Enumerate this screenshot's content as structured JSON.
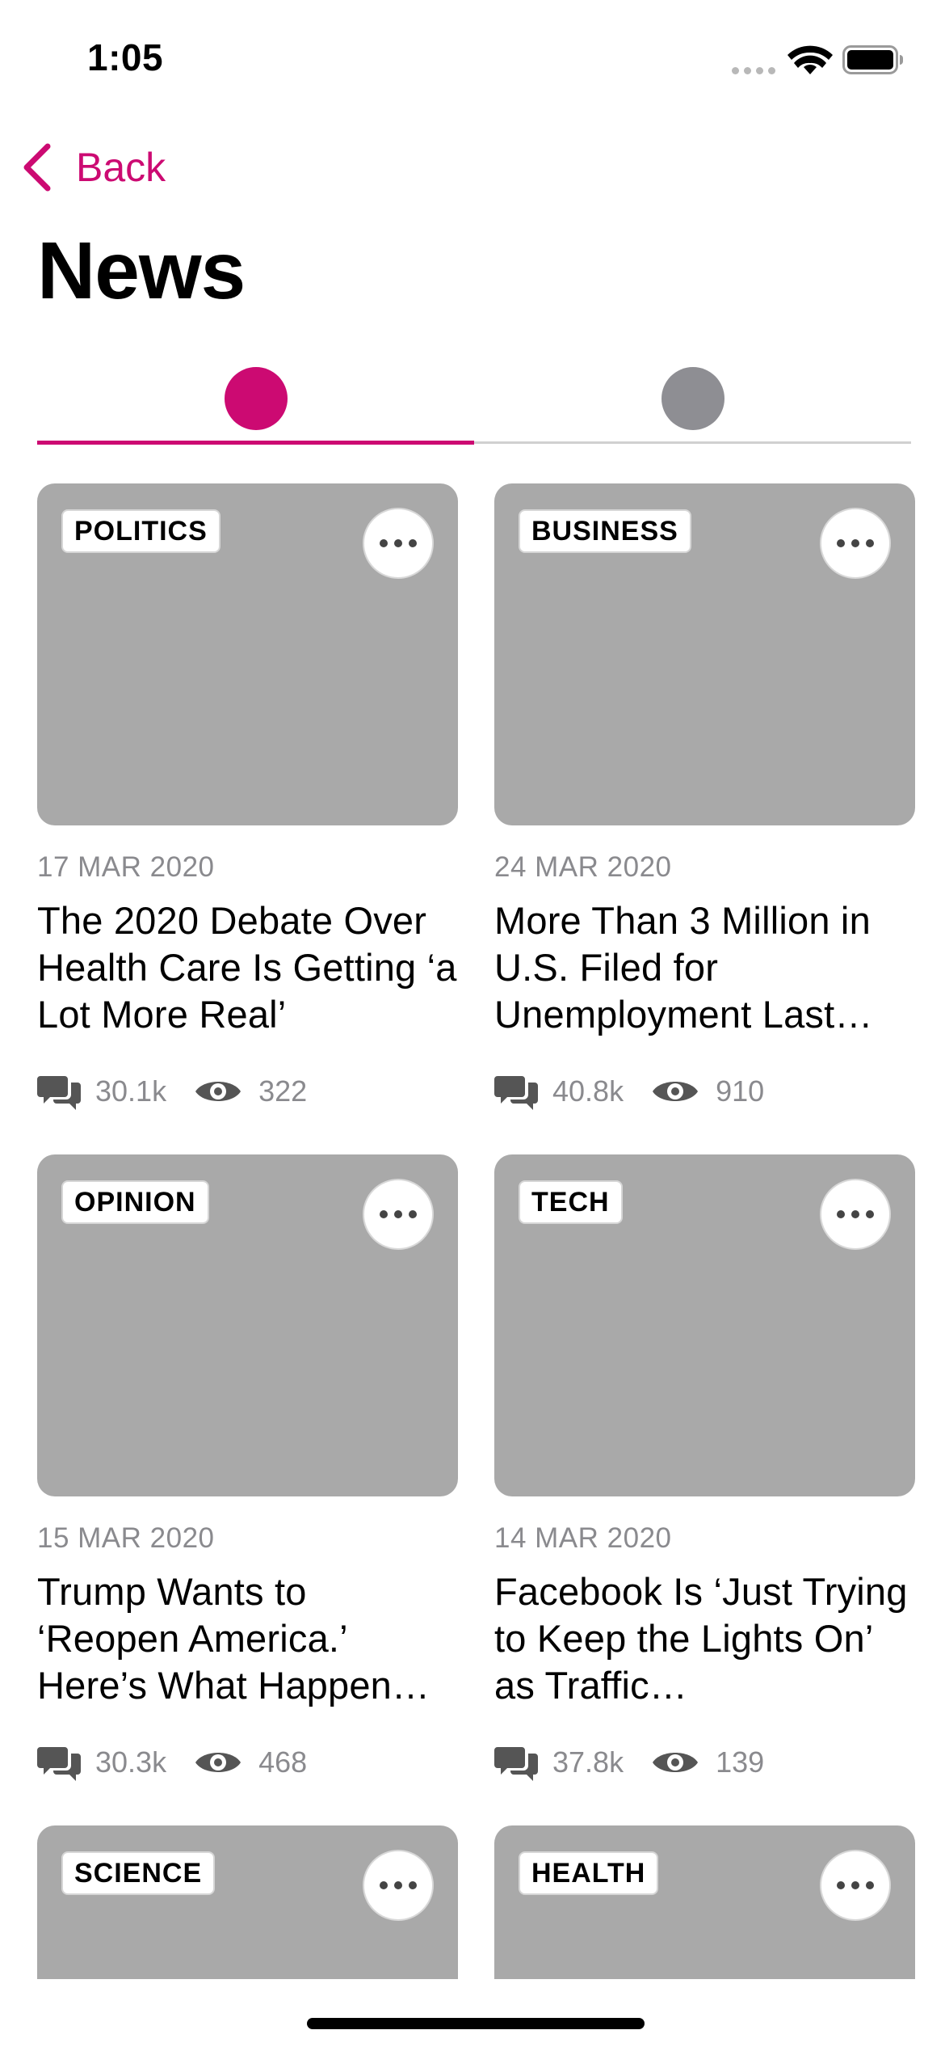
{
  "status_bar": {
    "time": "1:05"
  },
  "nav": {
    "back_label": "Back",
    "title": "News"
  },
  "tabs": {
    "active_color": "#cc0a72",
    "inactive_color": "#8e8e93"
  },
  "articles": [
    {
      "category": "POLITICS",
      "date": "17 MAR 2020",
      "title": "The 2020 Debate Over Health Care Is Getting ‘a Lot More Real’",
      "comments": "30.1k",
      "views": "322"
    },
    {
      "category": "BUSINESS",
      "date": "24 MAR 2020",
      "title": "More Than 3 Million in U.S. Filed for Unemployment Last…",
      "comments": "40.8k",
      "views": "910"
    },
    {
      "category": "OPINION",
      "date": "15 MAR 2020",
      "title": "Trump Wants to ‘Reopen America.’ Here’s What Happen…",
      "comments": "30.3k",
      "views": "468"
    },
    {
      "category": "TECH",
      "date": "14 MAR 2020",
      "title": "Facebook Is ‘Just Trying to Keep the Lights On’ as Traffic…",
      "comments": "37.8k",
      "views": "139"
    },
    {
      "category": "SCIENCE"
    },
    {
      "category": "HEALTH"
    }
  ],
  "colors": {
    "accent": "#cc0a72",
    "image_placeholder": "#a9a9a9",
    "meta_text": "#8a8a8e"
  },
  "icons": {
    "back": "chevron-left-icon",
    "wifi": "wifi-icon",
    "battery": "battery-icon",
    "more": "ellipsis-icon",
    "comments": "comments-icon",
    "views": "eye-icon"
  }
}
